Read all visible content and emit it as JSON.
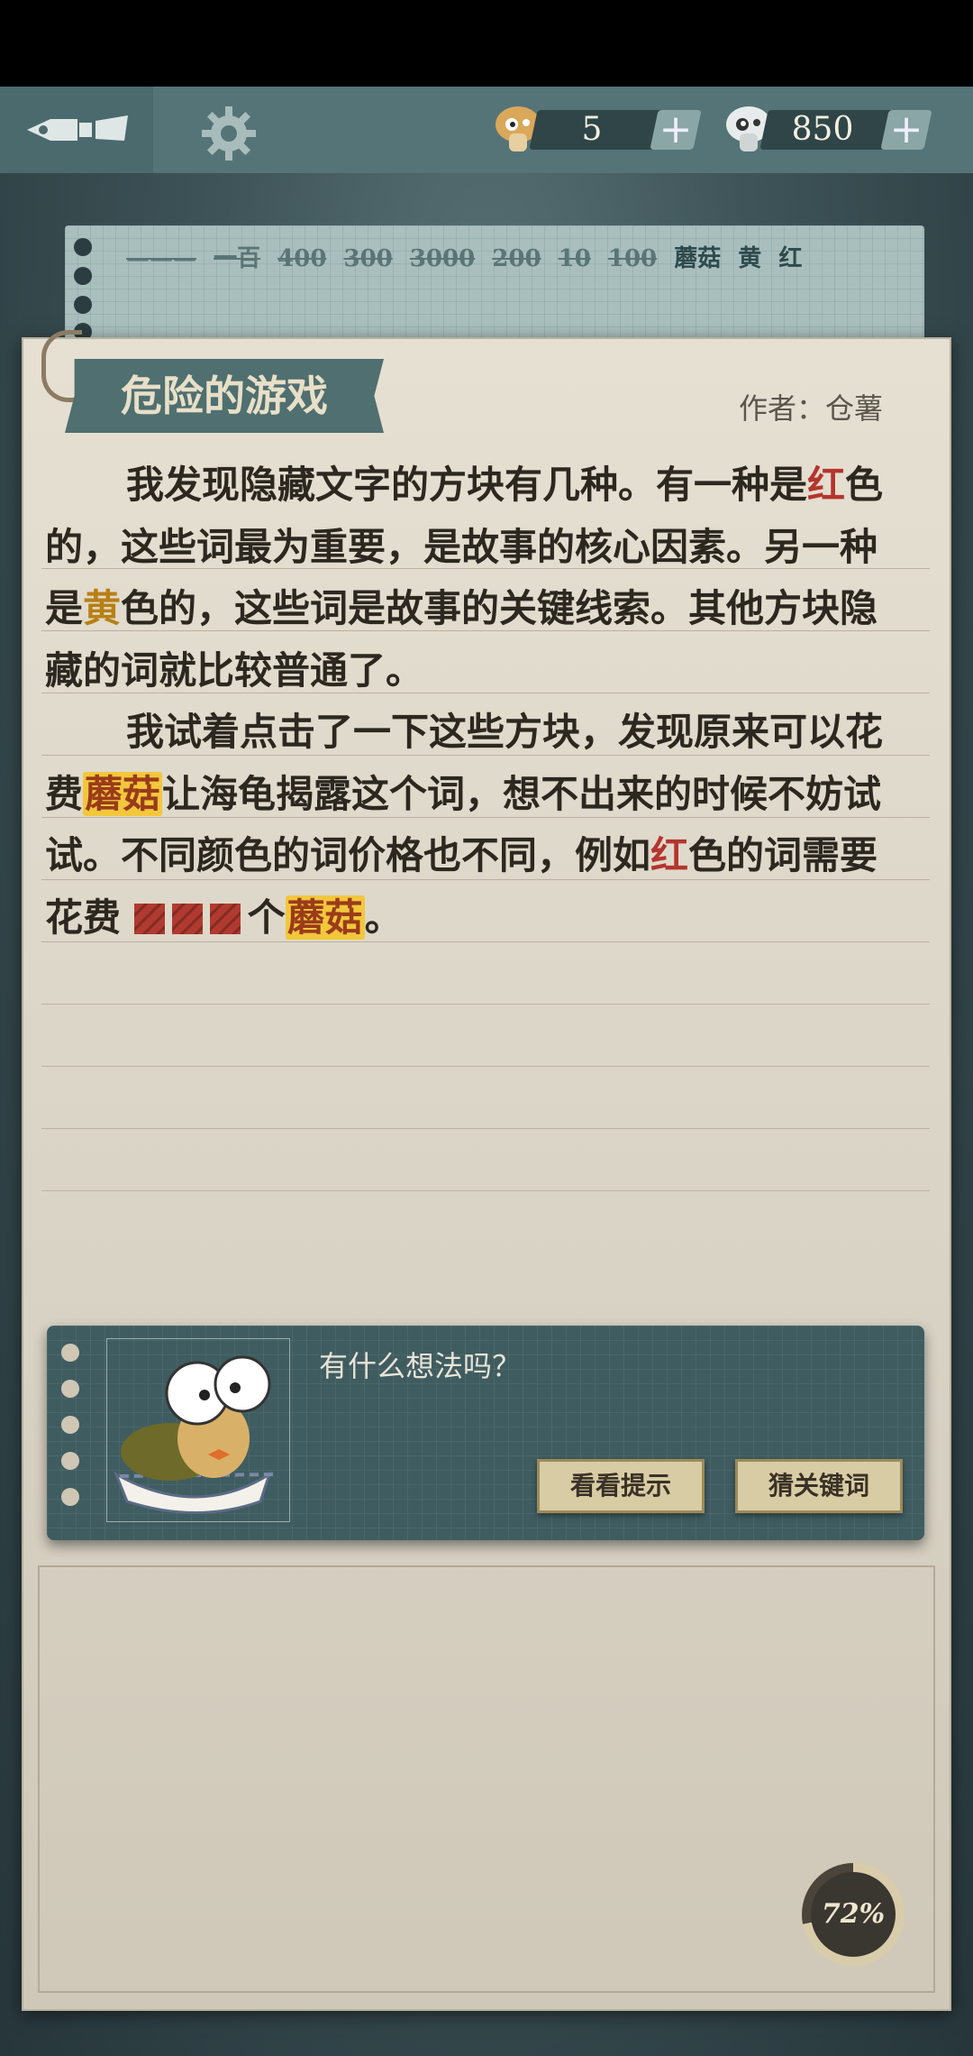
{
  "topbar": {
    "mushroom_gold_count": "5",
    "mushroom_white_count": "850",
    "plus_label": "+"
  },
  "keywords": [
    "———",
    "一百",
    "400",
    "300",
    "3000",
    "200",
    "10",
    "100",
    "蘑菇",
    "黄",
    "红"
  ],
  "story": {
    "title": "危险的游戏",
    "author": "作者：仓薯",
    "p1_a": "我发现隐藏文字的方块有几种。有一种是",
    "p1_red": "红",
    "p1_b": "色的，这些词最为重要，是故事的核心因素。另一种是",
    "p1_yellow": "黄",
    "p1_c": "色的，这些词是故事的关键线索。其他方块隐藏的词就比较普通了。",
    "p2_a": "我试着点击了一下这些方块，发现原来可以花费",
    "p2_mushroom1": "蘑菇",
    "p2_b": "让海龟揭露这个词，想不出来的时候不妨试试。不同颜色的词价格也不同，例如",
    "p2_red": "红",
    "p2_c": "色的词需要花费",
    "p2_d": "个",
    "p2_mushroom2": "蘑菇",
    "p2_e": "。"
  },
  "dialog": {
    "question": "有什么想法吗？",
    "hint_button": "看看提示",
    "guess_button": "猜关键词"
  },
  "progress": {
    "label": "72%",
    "value": 0.72
  },
  "colors": {
    "red_word": "#b4352e",
    "yellow_word": "#b78015",
    "highlight": "#f2c73c"
  }
}
